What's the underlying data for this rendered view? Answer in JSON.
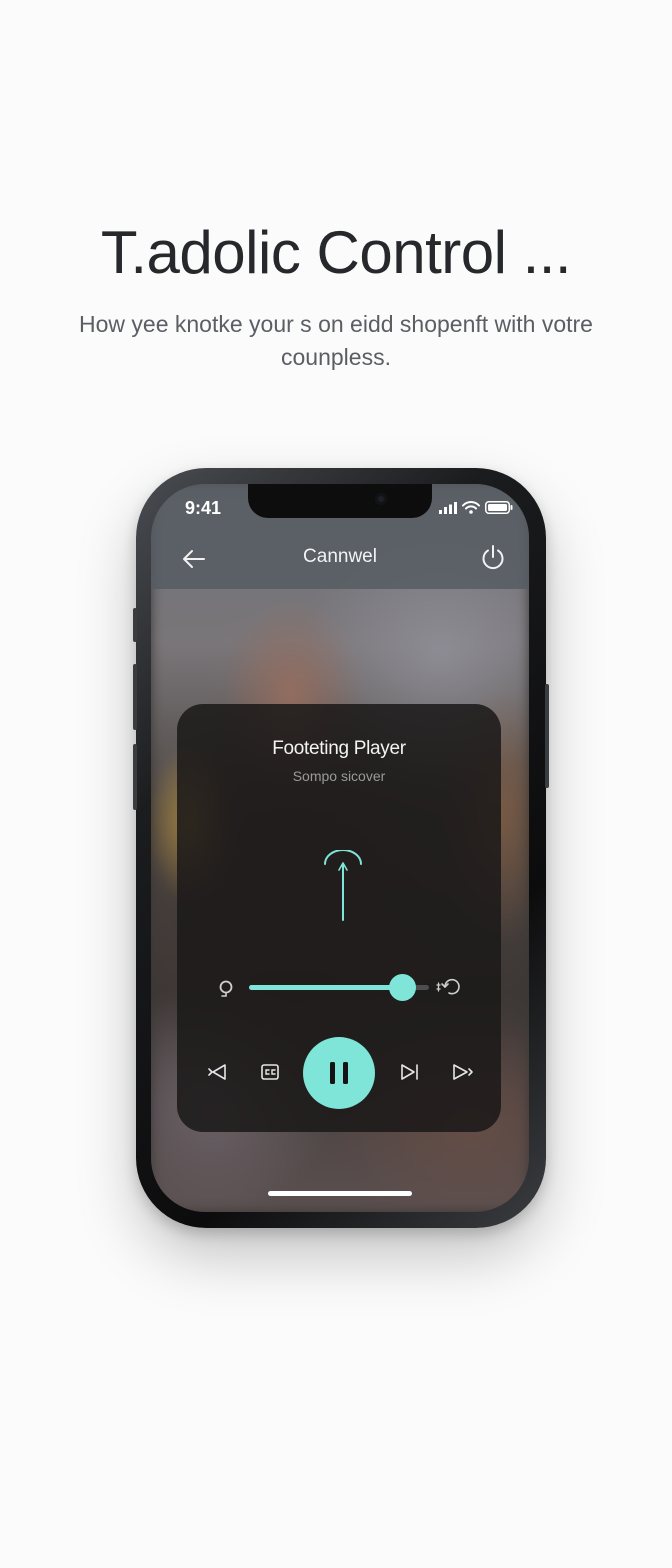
{
  "page": {
    "headline": "T.adolic Control ...",
    "subline": "How yee knotke your s on eidd shopenft with votre counpless."
  },
  "phone": {
    "status_bar": {
      "time": "9:41",
      "icons": [
        "cellular-signal-icon",
        "wifi-icon",
        "battery-icon"
      ]
    },
    "nav": {
      "title": "Cannwel",
      "back_icon": "arrow-left-icon",
      "action_icon": "power-icon"
    },
    "player": {
      "title": "Footeting Player",
      "subtitle": "Sompo sicover",
      "visual_icon": "arc-arrow-up-icon",
      "slider": {
        "left_icon": "dial-icon",
        "right_icon": "refresh-icon",
        "value": 0.85
      },
      "controls": [
        {
          "name": "rewind-icon"
        },
        {
          "name": "caption-icon"
        },
        {
          "name": "pause-icon",
          "primary": true
        },
        {
          "name": "skip-next-icon"
        },
        {
          "name": "fast-forward-icon"
        }
      ]
    },
    "accent_color": "#7ee5d8"
  }
}
